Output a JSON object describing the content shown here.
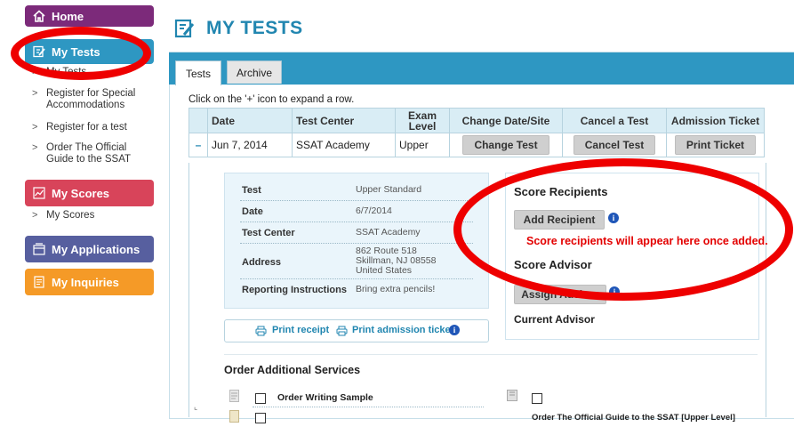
{
  "sidebar": {
    "home": "Home",
    "my_tests": "My Tests",
    "partial_item": "My Tests",
    "test_items": [
      "Register for Special Accommodations",
      "Register for a test",
      "Order The Official Guide to the SSAT"
    ],
    "my_scores": "My Scores",
    "score_items": [
      "My Scores"
    ],
    "my_applications": "My Applications",
    "my_inquiries": "My Inquiries",
    "colors": {
      "home": "#7c2a7a",
      "my_tests": "#2e97c2",
      "my_scores": "#d8445a",
      "my_applications": "#575f9f",
      "my_inquiries": "#f59a27"
    }
  },
  "header": {
    "title": "MY TESTS",
    "icon": "edit-document-icon"
  },
  "tabs": [
    {
      "label": "Tests",
      "active": true
    },
    {
      "label": "Archive",
      "active": false
    }
  ],
  "hint": "Click on the '+' icon to expand a row.",
  "table": {
    "columns": [
      "Date",
      "Test Center",
      "Exam Level",
      "Change Date/Site",
      "Cancel a Test",
      "Admission Ticket"
    ],
    "rows": [
      {
        "toggle": "–",
        "date": "Jun 7, 2014",
        "center": "SSAT Academy",
        "level": "Upper",
        "change": "Change Test",
        "cancel": "Cancel Test",
        "ticket": "Print Ticket"
      }
    ]
  },
  "details": {
    "labels": {
      "test": "Test",
      "date": "Date",
      "center": "Test Center",
      "address": "Address",
      "instructions": "Reporting Instructions"
    },
    "values": {
      "test": "Upper Standard",
      "date": "6/7/2014",
      "center": "SSAT Academy",
      "address_lines": [
        "862 Route 518",
        "Skillman, NJ 08558",
        "United States"
      ],
      "instructions": "Bring extra pencils!"
    },
    "print_receipt": "Print receipt",
    "print_admission": "Print admission ticket"
  },
  "score_recipients": {
    "title": "Score Recipients",
    "add_button": "Add Recipient",
    "message": "Score recipients will appear here once added."
  },
  "advisor": {
    "title": "Score Advisor",
    "assign_button": "Assign Advisor",
    "current_label": "Current Advisor"
  },
  "services": {
    "title": "Order Additional Services",
    "writing_sample": "Order Writing Sample",
    "guide": "Order The Official Guide to the SSAT [Upper Level]"
  }
}
